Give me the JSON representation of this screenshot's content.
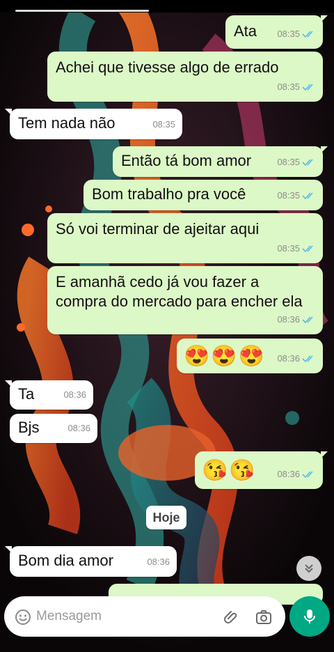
{
  "messages": [
    {
      "id": "m1",
      "dir": "out",
      "text": "Ata",
      "time": "08:35",
      "status": "read"
    },
    {
      "id": "m2",
      "dir": "out",
      "text": "Achei que tivesse algo de errado",
      "time": "08:35",
      "status": "read"
    },
    {
      "id": "m3",
      "dir": "in",
      "text": "Tem nada não",
      "time": "08:35"
    },
    {
      "id": "m4",
      "dir": "out",
      "text": "Então tá bom amor",
      "time": "08:35",
      "status": "read"
    },
    {
      "id": "m5",
      "dir": "out",
      "text": "Bom trabalho pra você",
      "time": "08:35",
      "status": "read"
    },
    {
      "id": "m6",
      "dir": "out",
      "text": "Só voi terminar de ajeitar aqui",
      "time": "08:35",
      "status": "read"
    },
    {
      "id": "m7",
      "dir": "out",
      "lines": [
        "E amanhã cedo já vou fazer a",
        "compra do mercado para encher ela"
      ],
      "time": "08:36",
      "status": "read"
    },
    {
      "id": "m8",
      "dir": "out",
      "emoji": "😍😍😍",
      "time": "08:36",
      "status": "read"
    },
    {
      "id": "m9",
      "dir": "in",
      "text": "Ta",
      "time": "08:36"
    },
    {
      "id": "m10",
      "dir": "in",
      "text": "Bjs",
      "time": "08:36"
    },
    {
      "id": "m11",
      "dir": "out",
      "emoji": "😘😘",
      "time": "08:36",
      "status": "read"
    },
    {
      "id": "m12",
      "dir": "in",
      "text": "Bom dia amor",
      "time": "08:36"
    }
  ],
  "day_separator": "Hoje",
  "composer": {
    "placeholder": "Mensagem",
    "icons": [
      "emoji-icon",
      "attach-icon",
      "camera-icon",
      "mic-icon"
    ]
  },
  "colors": {
    "outgoing_bubble": "#dcf8c6",
    "incoming_bubble": "#ffffff",
    "read_ticks": "#53bdeb",
    "mic_button": "#00a884"
  }
}
